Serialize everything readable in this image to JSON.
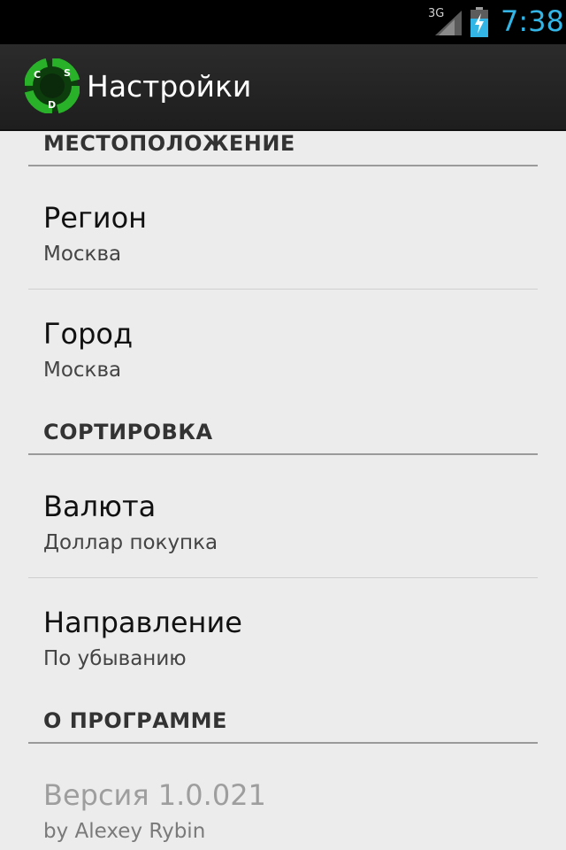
{
  "status_bar": {
    "network": "3G",
    "time": "7:38",
    "signal_icon": "signal-icon",
    "battery_icon": "battery-charging-icon"
  },
  "action_bar": {
    "title": "Настройки",
    "app_icon": "currency-app-icon",
    "app_icon_letters": [
      "C",
      "S",
      "D"
    ]
  },
  "sections": [
    {
      "header": "МЕСТОПОЛОЖЕНИЕ",
      "items": [
        {
          "title": "Регион",
          "summary": "Москва"
        },
        {
          "title": "Город",
          "summary": "Москва"
        }
      ]
    },
    {
      "header": "СОРТИРОВКА",
      "items": [
        {
          "title": "Валюта",
          "summary": "Доллар покупка"
        },
        {
          "title": "Направление",
          "summary": "По убыванию"
        }
      ]
    },
    {
      "header": "О ПРОГРАММЕ",
      "items": [
        {
          "title": "Версия 1.0.021",
          "summary": "by Alexey Rybin",
          "disabled": true
        }
      ]
    }
  ],
  "colors": {
    "status_accent": "#33b5e5",
    "action_bar_bg": "#222222",
    "list_bg": "#ececec",
    "icon_green": "#1fa01f"
  }
}
